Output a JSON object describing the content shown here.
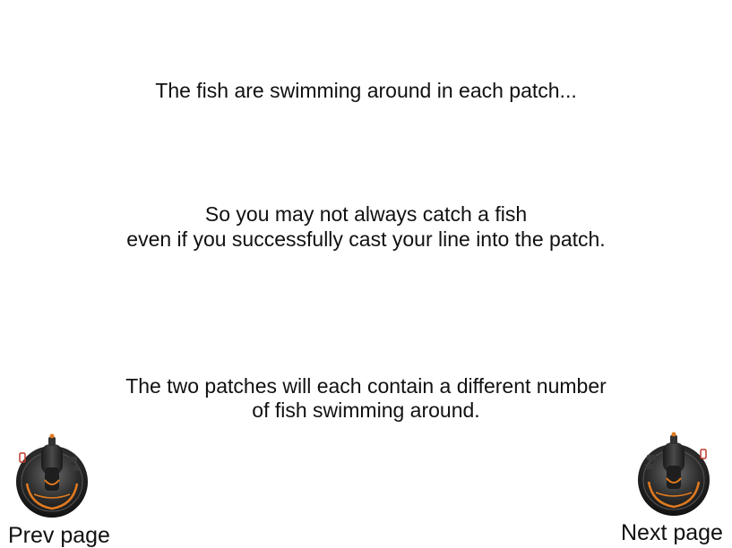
{
  "instructions": {
    "line1": "The fish are swimming around in each patch...",
    "line2a": "So you may not always catch a fish",
    "line2b": "even if you successfully cast your line into the patch.",
    "line3a": "The two patches will each contain a different number",
    "line3b": "of fish swimming around."
  },
  "nav": {
    "prev_label": "Prev page",
    "next_label": "Next page",
    "prev_icon": "joystick-icon",
    "next_icon": "joystick-icon"
  },
  "colors": {
    "text": "#111111",
    "joystick_body": "#2a2a2a",
    "joystick_accent": "#e07a1f",
    "joystick_red": "#c0392b",
    "background": "#ffffff"
  }
}
